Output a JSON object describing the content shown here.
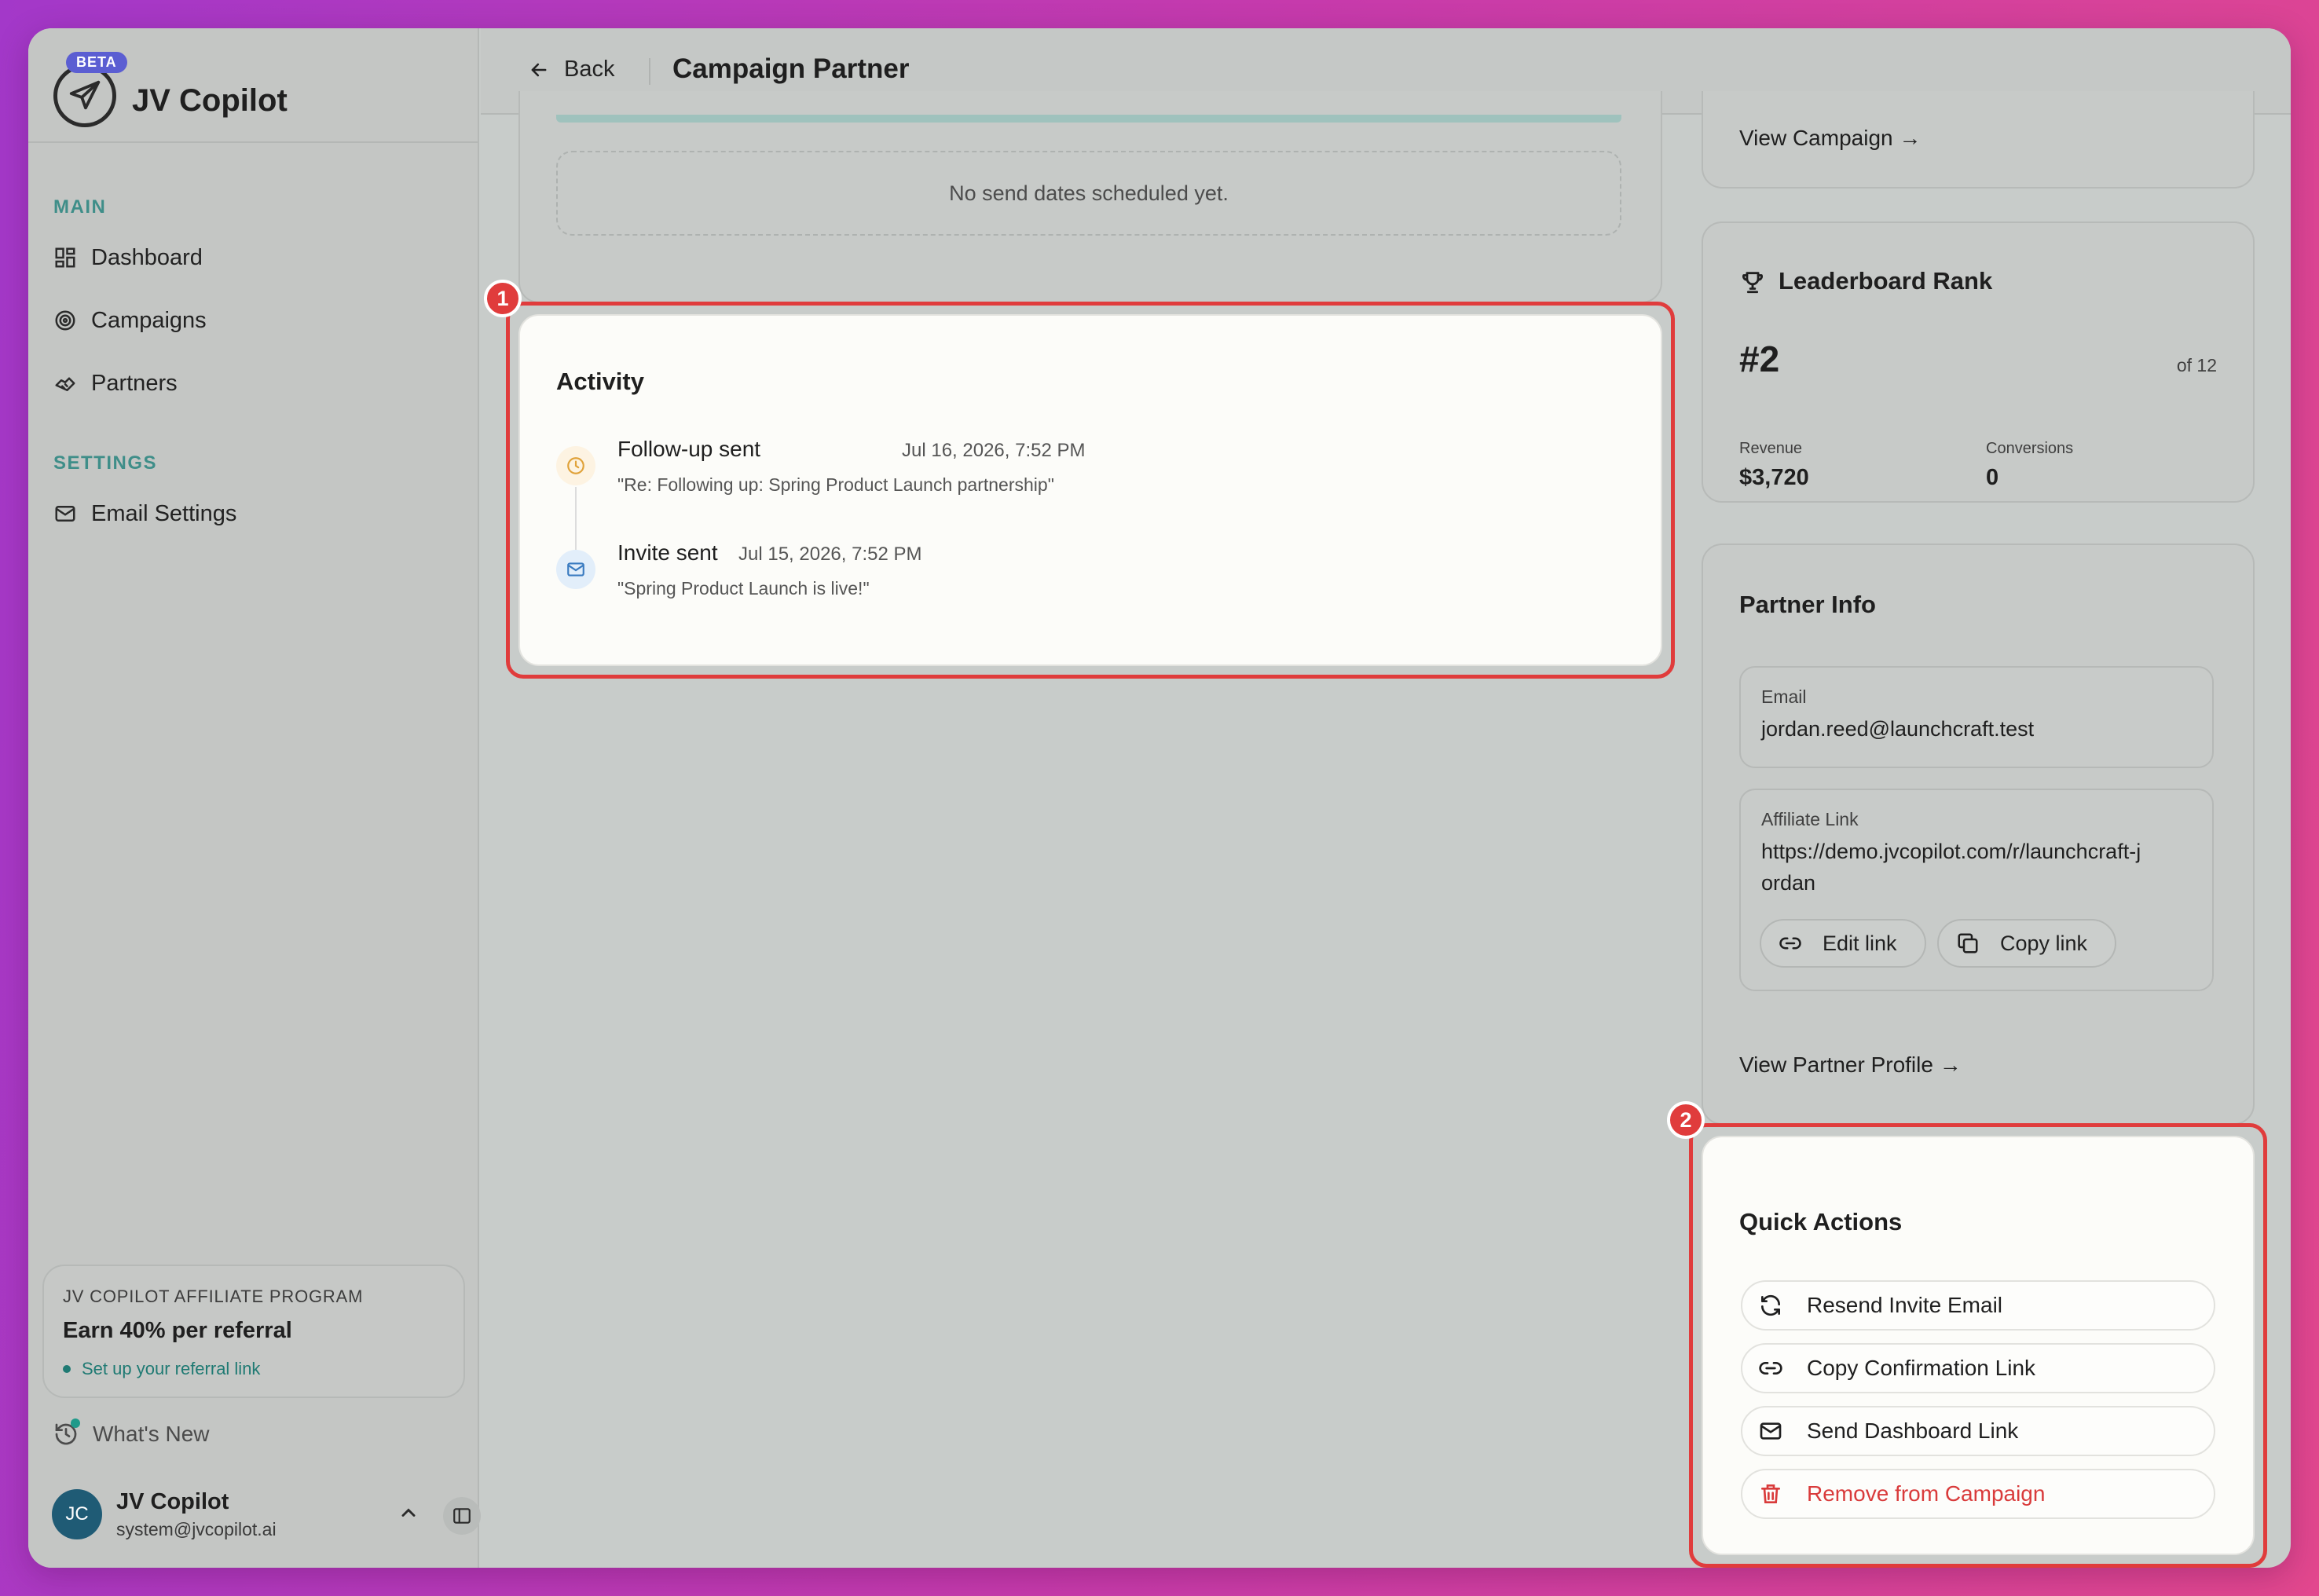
{
  "brand": {
    "name": "JV Copilot",
    "beta": "BETA"
  },
  "sidebar": {
    "main_label": "MAIN",
    "main_items": [
      {
        "label": "Dashboard",
        "icon": "dashboard-icon"
      },
      {
        "label": "Campaigns",
        "icon": "target-icon"
      },
      {
        "label": "Partners",
        "icon": "handshake-icon"
      }
    ],
    "settings_label": "SETTINGS",
    "settings_items": [
      {
        "label": "Email Settings",
        "icon": "mail-icon"
      }
    ],
    "promo": {
      "kicker": "JV COPILOT AFFILIATE PROGRAM",
      "title": "Earn 40% per referral",
      "link": "Set up your referral link"
    },
    "whats_new": "What's New",
    "user": {
      "initials": "JC",
      "name": "JV Copilot",
      "email": "system@jvcopilot.ai"
    }
  },
  "topbar": {
    "back": "Back",
    "title": "Campaign Partner"
  },
  "schedule": {
    "empty": "No send dates scheduled yet."
  },
  "activity": {
    "title": "Activity",
    "items": [
      {
        "title": "Follow-up sent",
        "time": "Jul 16, 2026, 7:52 PM",
        "quote": "\"Re: Following up: Spring Product Launch partnership\"",
        "icon": "clock-icon"
      },
      {
        "title": "Invite sent",
        "time": "Jul 15, 2026, 7:52 PM",
        "quote": "\"Spring Product Launch is live!\"",
        "icon": "mail-icon"
      }
    ]
  },
  "campaign_card": {
    "link": "View Campaign →"
  },
  "leaderboard": {
    "title": "Leaderboard Rank",
    "rank": "#2",
    "of": "of 12",
    "revenue_label": "Revenue",
    "revenue": "$3,720",
    "conversions_label": "Conversions",
    "conversions": "0"
  },
  "partner_info": {
    "title": "Partner Info",
    "email_label": "Email",
    "email": "jordan.reed@launchcraft.test",
    "affiliate_label": "Affiliate Link",
    "affiliate_line1": "https://demo.jvcopilot.com/r/launchcraft-j",
    "affiliate_line2": "ordan",
    "edit_link": "Edit link",
    "copy_link": "Copy link",
    "profile_link": "View Partner Profile →"
  },
  "quick_actions": {
    "title": "Quick Actions",
    "resend": "Resend Invite Email",
    "copy_confirmation": "Copy Confirmation Link",
    "send_dashboard": "Send Dashboard Link",
    "remove": "Remove from Campaign"
  },
  "annotations": {
    "one": "1",
    "two": "2"
  },
  "colors": {
    "accent": "#3f8e89",
    "danger": "#d93b3b",
    "highlight": "#e03c3c",
    "beta": "#5b5ed2"
  }
}
